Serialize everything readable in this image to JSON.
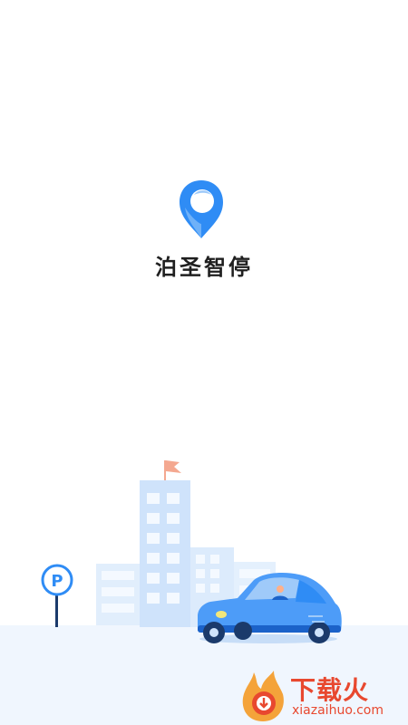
{
  "app": {
    "name": "泊圣智停"
  },
  "illustration": {
    "parking_sign_letter": "P"
  },
  "watermark": {
    "title": "下载火",
    "url": "xiazaihuo.com"
  },
  "colors": {
    "brand_blue": "#2f8cf5",
    "light_blue": "#a9cff8",
    "building": "#cfe3fb",
    "ground": "#f0f6fe",
    "flag": "#f4a890",
    "watermark": "#e8482f"
  }
}
